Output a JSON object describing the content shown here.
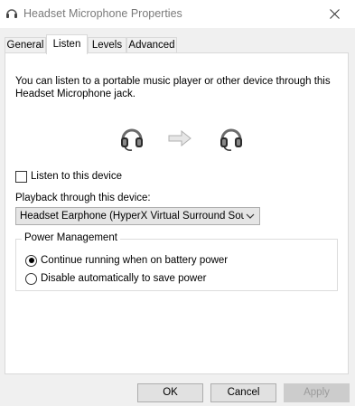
{
  "window": {
    "title": "Headset Microphone Properties",
    "title_icon": "headset-icon",
    "close_icon": "close-icon"
  },
  "tabs": [
    {
      "label": "General",
      "active": false
    },
    {
      "label": "Listen",
      "active": true
    },
    {
      "label": "Levels",
      "active": false
    },
    {
      "label": "Advanced",
      "active": false
    }
  ],
  "listen": {
    "description": "You can listen to a portable music player or other device through this Headset Microphone jack.",
    "source_icon": "headset-icon",
    "arrow_icon": "arrow-right-icon",
    "target_icon": "headset-icon",
    "listen_checkbox": {
      "label": "Listen to this device",
      "checked": false
    },
    "playback_label": "Playback through this device:",
    "playback_selected": "Headset Earphone (HyperX Virtual Surround Sou"
  },
  "power": {
    "legend": "Power Management",
    "options": [
      {
        "label": "Continue running when on battery power",
        "selected": true
      },
      {
        "label": "Disable automatically to save power",
        "selected": false
      }
    ]
  },
  "buttons": {
    "ok": "OK",
    "cancel": "Cancel",
    "apply": "Apply"
  }
}
